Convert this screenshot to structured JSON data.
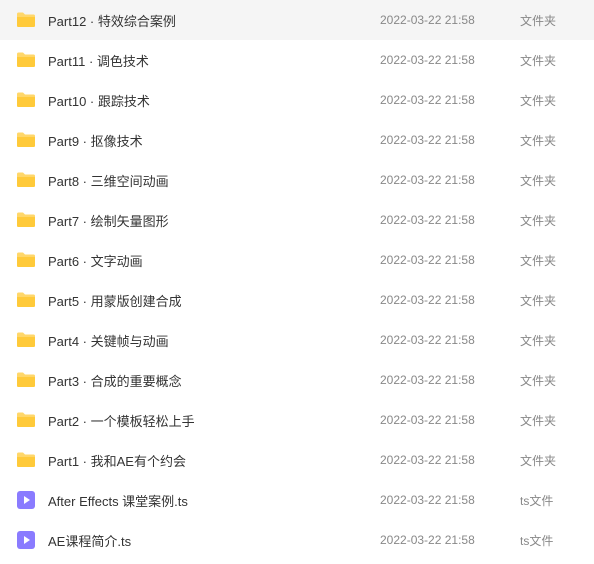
{
  "files": [
    {
      "icon": "folder",
      "name": "Part12 · 特效综合案例",
      "date": "2022-03-22 21:58",
      "type": "文件夹"
    },
    {
      "icon": "folder",
      "name": "Part11 · 调色技术",
      "date": "2022-03-22 21:58",
      "type": "文件夹"
    },
    {
      "icon": "folder",
      "name": "Part10 · 跟踪技术",
      "date": "2022-03-22 21:58",
      "type": "文件夹"
    },
    {
      "icon": "folder",
      "name": "Part9 · 抠像技术",
      "date": "2022-03-22 21:58",
      "type": "文件夹"
    },
    {
      "icon": "folder",
      "name": "Part8 · 三维空间动画",
      "date": "2022-03-22 21:58",
      "type": "文件夹"
    },
    {
      "icon": "folder",
      "name": "Part7 · 绘制矢量图形",
      "date": "2022-03-22 21:58",
      "type": "文件夹"
    },
    {
      "icon": "folder",
      "name": "Part6 · 文字动画",
      "date": "2022-03-22 21:58",
      "type": "文件夹"
    },
    {
      "icon": "folder",
      "name": "Part5 · 用蒙版创建合成",
      "date": "2022-03-22 21:58",
      "type": "文件夹"
    },
    {
      "icon": "folder",
      "name": "Part4 · 关键帧与动画",
      "date": "2022-03-22 21:58",
      "type": "文件夹"
    },
    {
      "icon": "folder",
      "name": "Part3 · 合成的重要概念",
      "date": "2022-03-22 21:58",
      "type": "文件夹"
    },
    {
      "icon": "folder",
      "name": "Part2 · 一个模板轻松上手",
      "date": "2022-03-22 21:58",
      "type": "文件夹"
    },
    {
      "icon": "folder",
      "name": "Part1 · 我和AE有个约会",
      "date": "2022-03-22 21:58",
      "type": "文件夹"
    },
    {
      "icon": "video",
      "name": "After Effects 课堂案例.ts",
      "date": "2022-03-22 21:58",
      "type": "ts文件"
    },
    {
      "icon": "video",
      "name": "AE课程简介.ts",
      "date": "2022-03-22 21:58",
      "type": "ts文件"
    }
  ]
}
